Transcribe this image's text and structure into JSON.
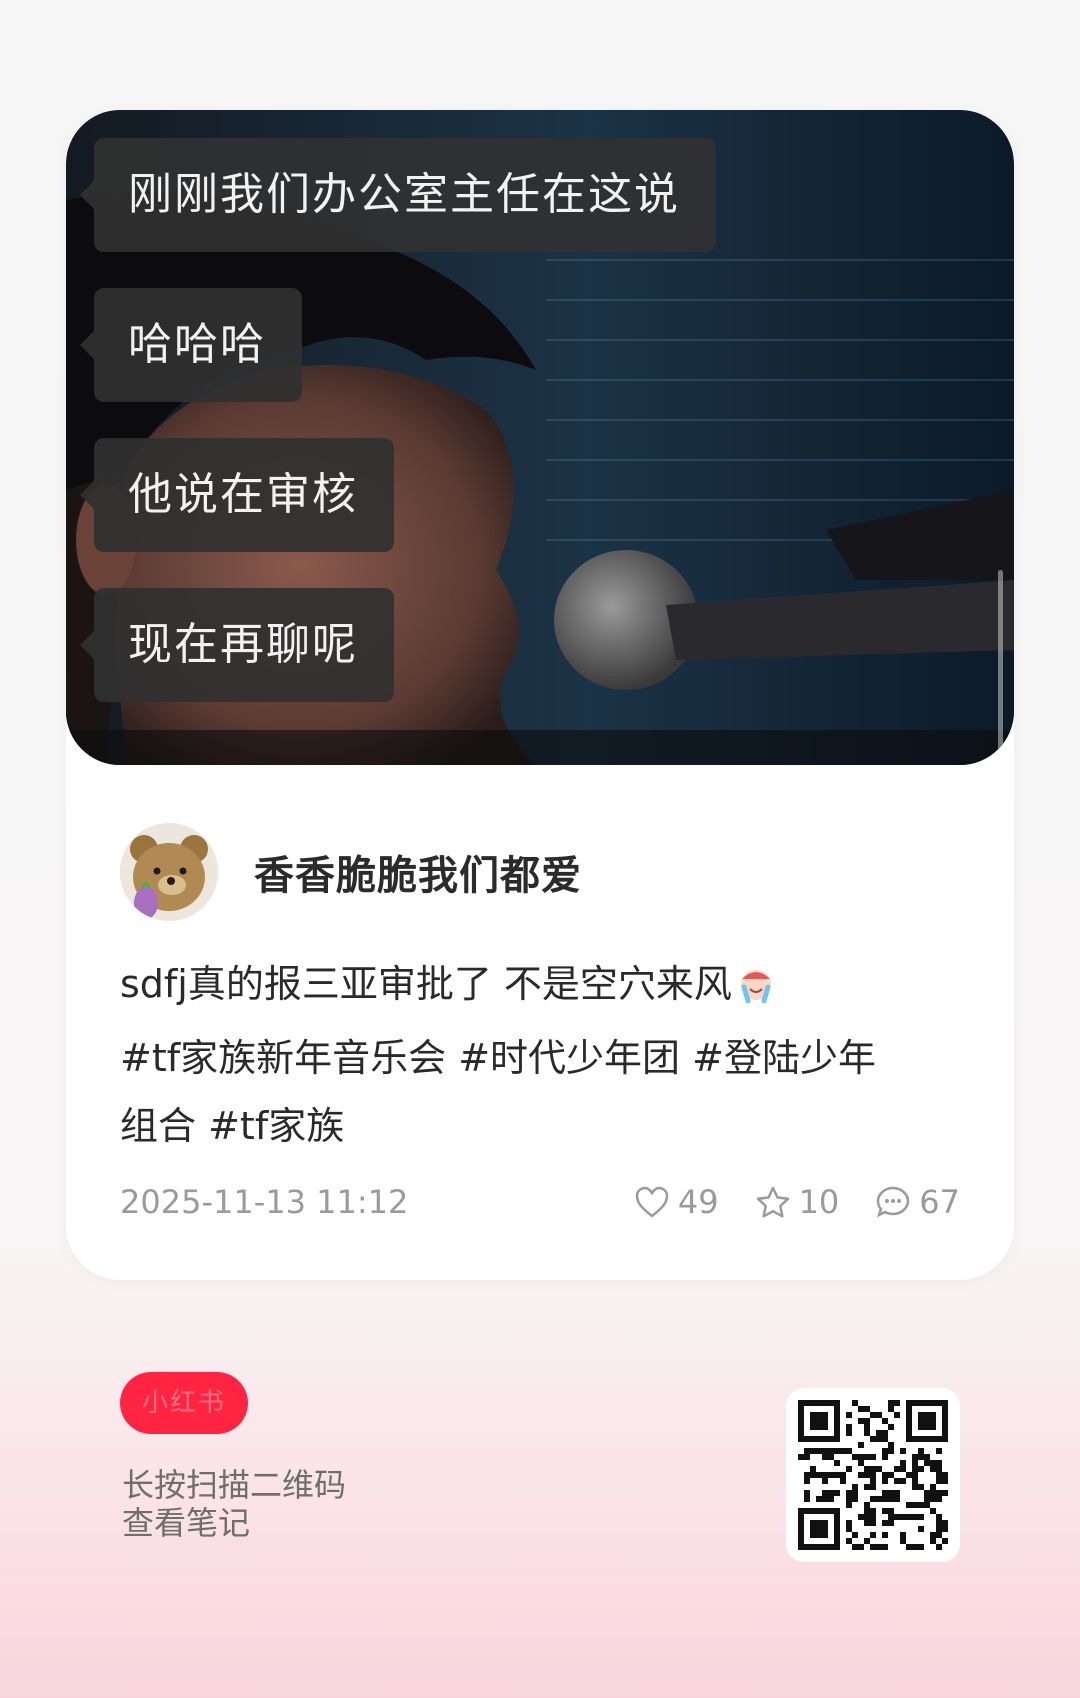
{
  "chat": {
    "messages": [
      "刚刚我们办公室主任在这说",
      "哈哈哈",
      "他说在审核",
      "现在再聊呢"
    ]
  },
  "note": {
    "author_name": "香香脆脆我们都爱",
    "text": "sdfj真的报三亚审批了 不是空穴来风",
    "tags_line1": "#tf家族新年音乐会 #时代少年团 #登陆少年",
    "tags_line2": "组合 #tf家族",
    "timestamp": "2025-11-13 11:12",
    "likes": "49",
    "collects": "10",
    "comments": "67",
    "emoji_icon": "crying-face-emoji"
  },
  "footer": {
    "pill_label": "小红书",
    "hint_line1": "长按扫描二维码",
    "hint_line2": "查看笔记"
  },
  "colors": {
    "brand_red": "#ff2442",
    "bubble_bg": "#303030",
    "meta_gray": "#9a9a9a"
  }
}
